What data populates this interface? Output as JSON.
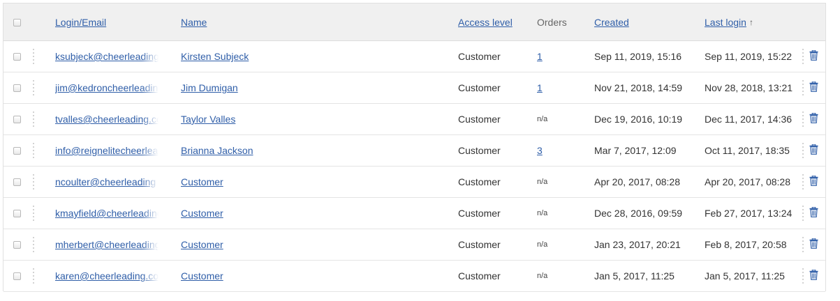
{
  "table": {
    "headers": {
      "login": "Login/Email",
      "name": "Name",
      "access_level": "Access level",
      "orders": "Orders",
      "created": "Created",
      "last_login": "Last login"
    },
    "sort": {
      "column": "last_login",
      "direction_icon": "arrow-up-icon",
      "glyph": "↑"
    },
    "rows": [
      {
        "login": "ksubjeck@cheerleading",
        "name": "Kirsten Subjeck",
        "access_level": "Customer",
        "orders": "1",
        "created": "Sep 11, 2019, 15:16",
        "last_login": "Sep 11, 2019, 15:22"
      },
      {
        "login": "jim@kedroncheerleading",
        "name": "Jim Dumigan",
        "access_level": "Customer",
        "orders": "1",
        "created": "Nov 21, 2018, 14:59",
        "last_login": "Nov 28, 2018, 13:21"
      },
      {
        "login": "tvalles@cheerleading.com",
        "name": "Taylor Valles",
        "access_level": "Customer",
        "orders": "n/a",
        "created": "Dec 19, 2016, 10:19",
        "last_login": "Dec 11, 2017, 14:36"
      },
      {
        "login": "info@reignelitecheerleading",
        "name": "Brianna Jackson",
        "access_level": "Customer",
        "orders": "3",
        "created": "Mar 7, 2017, 12:09",
        "last_login": "Oct 11, 2017, 18:35"
      },
      {
        "login": "ncoulter@cheerleading",
        "name": "Customer",
        "access_level": "Customer",
        "orders": "n/a",
        "created": "Apr 20, 2017, 08:28",
        "last_login": "Apr 20, 2017, 08:28"
      },
      {
        "login": "kmayfield@cheerleading",
        "name": "Customer",
        "access_level": "Customer",
        "orders": "n/a",
        "created": "Dec 28, 2016, 09:59",
        "last_login": "Feb 27, 2017, 13:24"
      },
      {
        "login": "mherbert@cheerleading",
        "name": "Customer",
        "access_level": "Customer",
        "orders": "n/a",
        "created": "Jan 23, 2017, 20:21",
        "last_login": "Feb 8, 2017, 20:58"
      },
      {
        "login": "karen@cheerleading.com",
        "name": "Customer",
        "access_level": "Customer",
        "orders": "n/a",
        "created": "Jan 5, 2017, 11:25",
        "last_login": "Jan 5, 2017, 11:25"
      }
    ]
  },
  "icons": {
    "row_handle": "drag-handle-icon",
    "delete": "trash-icon",
    "delete_color": "#2f5ea8"
  }
}
